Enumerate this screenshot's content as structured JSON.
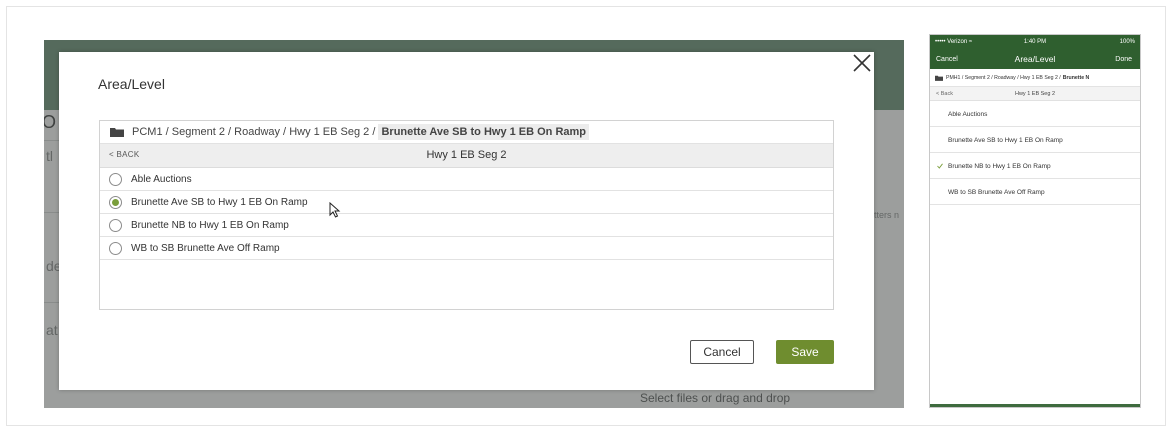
{
  "background": {
    "fragments": [
      "O",
      "tl",
      "de",
      "at"
    ],
    "side_text": "tters n",
    "upload_hint": "Select files or drag and drop"
  },
  "modal": {
    "title": "Area/Level",
    "breadcrumb": {
      "parts": [
        "PCM1 /",
        "Segment 2 /",
        "Roadway /",
        "Hwy 1 EB Seg 2 /"
      ],
      "current": "Brunette Ave SB to Hwy 1 EB On Ramp"
    },
    "back_label": "< BACK",
    "level_title": "Hwy 1 EB Seg 2",
    "options": [
      {
        "label": "Able Auctions",
        "selected": false
      },
      {
        "label": "Brunette Ave SB to Hwy 1 EB On Ramp",
        "selected": true
      },
      {
        "label": "Brunette NB to Hwy 1 EB On Ramp",
        "selected": false
      },
      {
        "label": "WB to SB Brunette Ave Off Ramp",
        "selected": false
      }
    ],
    "cancel_label": "Cancel",
    "save_label": "Save"
  },
  "phone": {
    "status": {
      "carrier": "••••• Verizon ≈",
      "time": "1:40 PM",
      "battery": "100%"
    },
    "nav": {
      "cancel": "Cancel",
      "title": "Area/Level",
      "done": "Done"
    },
    "breadcrumb": {
      "text": "PMH1 / Segment 2 / Roadway / Hwy 1 EB Seg 2 /",
      "current": "Brunette N"
    },
    "back_label": "< Back",
    "level_title": "Hwy 1 EB Seg 2",
    "items": [
      {
        "label": "Able Auctions",
        "checked": false
      },
      {
        "label": "Brunette Ave SB to Hwy 1 EB On Ramp",
        "checked": false
      },
      {
        "label": "Brunette NB to Hwy 1 EB On Ramp",
        "checked": true
      },
      {
        "label": "WB to SB Brunette Ave Off Ramp",
        "checked": false
      }
    ]
  },
  "colors": {
    "accent_green": "#6f8d2f",
    "radio_selected": "#7a9e3b",
    "phone_header": "#2f5f2f"
  }
}
